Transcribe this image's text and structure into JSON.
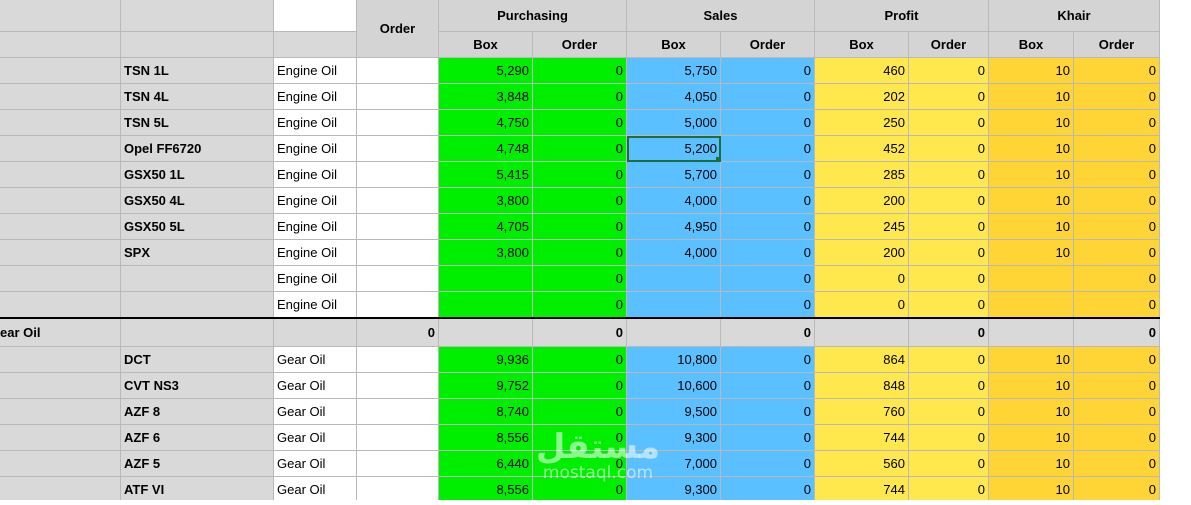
{
  "headers": {
    "order": "Order",
    "groups": [
      "Purchasing",
      "Sales",
      "Profit",
      "Khair"
    ],
    "sub": [
      "Box",
      "Order"
    ]
  },
  "engine_rows": [
    {
      "name": "TSN 1L",
      "type": "Engine Oil",
      "p_box": "5,290",
      "p_order": "0",
      "s_box": "5,750",
      "s_order": "0",
      "pr_box": "460",
      "pr_order": "0",
      "k_box": "10",
      "k_order": "0"
    },
    {
      "name": "TSN 4L",
      "type": "Engine Oil",
      "p_box": "3,848",
      "p_order": "0",
      "s_box": "4,050",
      "s_order": "0",
      "pr_box": "202",
      "pr_order": "0",
      "k_box": "10",
      "k_order": "0"
    },
    {
      "name": "TSN 5L",
      "type": "Engine Oil",
      "p_box": "4,750",
      "p_order": "0",
      "s_box": "5,000",
      "s_order": "0",
      "pr_box": "250",
      "pr_order": "0",
      "k_box": "10",
      "k_order": "0"
    },
    {
      "name": "Opel FF6720",
      "type": "Engine Oil",
      "p_box": "4,748",
      "p_order": "0",
      "s_box": "5,200",
      "s_order": "0",
      "pr_box": "452",
      "pr_order": "0",
      "k_box": "10",
      "k_order": "0"
    },
    {
      "name": "GSX50 1L",
      "type": "Engine Oil",
      "p_box": "5,415",
      "p_order": "0",
      "s_box": "5,700",
      "s_order": "0",
      "pr_box": "285",
      "pr_order": "0",
      "k_box": "10",
      "k_order": "0"
    },
    {
      "name": "GSX50 4L",
      "type": "Engine Oil",
      "p_box": "3,800",
      "p_order": "0",
      "s_box": "4,000",
      "s_order": "0",
      "pr_box": "200",
      "pr_order": "0",
      "k_box": "10",
      "k_order": "0"
    },
    {
      "name": "GSX50 5L",
      "type": "Engine Oil",
      "p_box": "4,705",
      "p_order": "0",
      "s_box": "4,950",
      "s_order": "0",
      "pr_box": "245",
      "pr_order": "0",
      "k_box": "10",
      "k_order": "0"
    },
    {
      "name": "SPX",
      "type": "Engine Oil",
      "p_box": "3,800",
      "p_order": "0",
      "s_box": "4,000",
      "s_order": "0",
      "pr_box": "200",
      "pr_order": "0",
      "k_box": "10",
      "k_order": "0"
    },
    {
      "name": "",
      "type": "Engine Oil",
      "p_box": "",
      "p_order": "0",
      "s_box": "",
      "s_order": "0",
      "pr_box": "0",
      "pr_order": "0",
      "k_box": "",
      "k_order": "0"
    },
    {
      "name": "",
      "type": "Engine Oil",
      "p_box": "",
      "p_order": "0",
      "s_box": "",
      "s_order": "0",
      "pr_box": "0",
      "pr_order": "0",
      "k_box": "",
      "k_order": "0"
    }
  ],
  "gear_summary": {
    "label": "ear Oil",
    "order": "0",
    "p_order": "0",
    "s_order": "0",
    "pr_order": "0",
    "k_order": "0"
  },
  "gear_rows": [
    {
      "name": "DCT",
      "type": "Gear Oil",
      "p_box": "9,936",
      "p_order": "0",
      "s_box": "10,800",
      "s_order": "0",
      "pr_box": "864",
      "pr_order": "0",
      "k_box": "10",
      "k_order": "0"
    },
    {
      "name": "CVT NS3",
      "type": "Gear Oil",
      "p_box": "9,752",
      "p_order": "0",
      "s_box": "10,600",
      "s_order": "0",
      "pr_box": "848",
      "pr_order": "0",
      "k_box": "10",
      "k_order": "0"
    },
    {
      "name": "AZF 8",
      "type": "Gear Oil",
      "p_box": "8,740",
      "p_order": "0",
      "s_box": "9,500",
      "s_order": "0",
      "pr_box": "760",
      "pr_order": "0",
      "k_box": "10",
      "k_order": "0"
    },
    {
      "name": "AZF 6",
      "type": "Gear Oil",
      "p_box": "8,556",
      "p_order": "0",
      "s_box": "9,300",
      "s_order": "0",
      "pr_box": "744",
      "pr_order": "0",
      "k_box": "10",
      "k_order": "0"
    },
    {
      "name": "AZF 5",
      "type": "Gear Oil",
      "p_box": "6,440",
      "p_order": "0",
      "s_box": "7,000",
      "s_order": "0",
      "pr_box": "560",
      "pr_order": "0",
      "k_box": "10",
      "k_order": "0"
    },
    {
      "name": "ATF VI",
      "type": "Gear Oil",
      "p_box": "8,556",
      "p_order": "0",
      "s_box": "9,300",
      "s_order": "0",
      "pr_box": "744",
      "pr_order": "0",
      "k_box": "10",
      "k_order": "0"
    }
  ],
  "selected_cell": "engine_rows.3.s_box",
  "watermark": {
    "main": "مستقل",
    "sub": "mostaql.com"
  },
  "colors": {
    "purchasing": "#00ee00",
    "sales": "#5ac0ff",
    "profit": "#ffe84d",
    "khair": "#ffd535",
    "header": "#d4d4d4"
  }
}
